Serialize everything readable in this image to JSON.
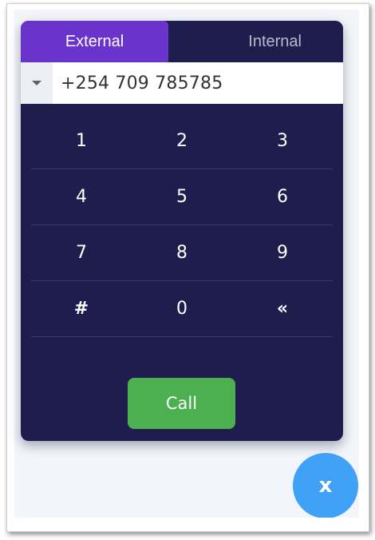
{
  "tabs": {
    "external_label": "External",
    "internal_label": "Internal",
    "active": "External"
  },
  "number_field": {
    "value": "+254 709 785785",
    "country_select_icon": "caret-down-icon"
  },
  "keypad": {
    "rows": [
      [
        "1",
        "2",
        "3"
      ],
      [
        "4",
        "5",
        "6"
      ],
      [
        "7",
        "8",
        "9"
      ],
      [
        "#",
        "0",
        "«"
      ]
    ]
  },
  "call_button": {
    "label": "Call"
  },
  "close_button": {
    "label": "x"
  },
  "colors": {
    "panel_bg": "#1f1d4d",
    "active_tab": "#6a34cc",
    "call_green": "#4caf50",
    "fab_blue": "#3fa2f7"
  }
}
